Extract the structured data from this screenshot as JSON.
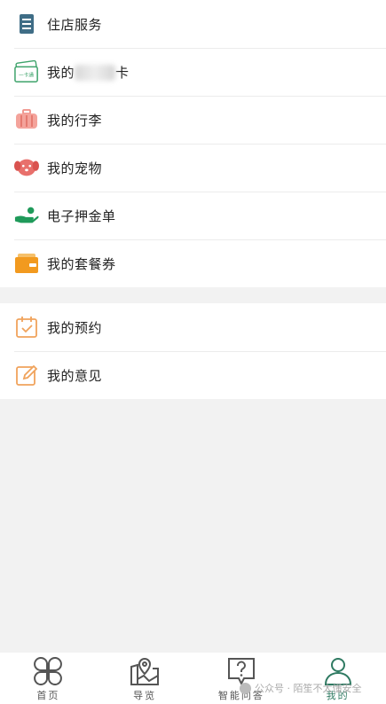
{
  "menu_group_1": [
    {
      "label": "住店服务",
      "icon": "hotel-service-icon"
    },
    {
      "label": "我的",
      "suffix": "卡",
      "redacted": true,
      "icon": "one-card-icon",
      "icon_text": "一卡通"
    },
    {
      "label": "我的行李",
      "icon": "luggage-icon"
    },
    {
      "label": "我的宠物",
      "icon": "pet-icon"
    },
    {
      "label": "电子押金单",
      "icon": "deposit-hand-icon"
    },
    {
      "label": "我的套餐券",
      "icon": "wallet-coupon-icon"
    }
  ],
  "menu_group_2": [
    {
      "label": "我的预约",
      "icon": "calendar-check-icon"
    },
    {
      "label": "我的意见",
      "icon": "edit-feedback-icon"
    }
  ],
  "tabbar": [
    {
      "label": "首页",
      "icon": "home-clover-icon",
      "active": false
    },
    {
      "label": "导览",
      "icon": "map-pin-icon",
      "active": false
    },
    {
      "label": "智能问答",
      "icon": "question-bubble-icon",
      "active": false
    },
    {
      "label": "我的",
      "icon": "user-profile-icon",
      "active": true
    }
  ],
  "watermark": {
    "text": "公众号 · 陌笙不太懂安全"
  },
  "colors": {
    "active_tab": "#2f7a62",
    "background": "#f2f2f2"
  }
}
